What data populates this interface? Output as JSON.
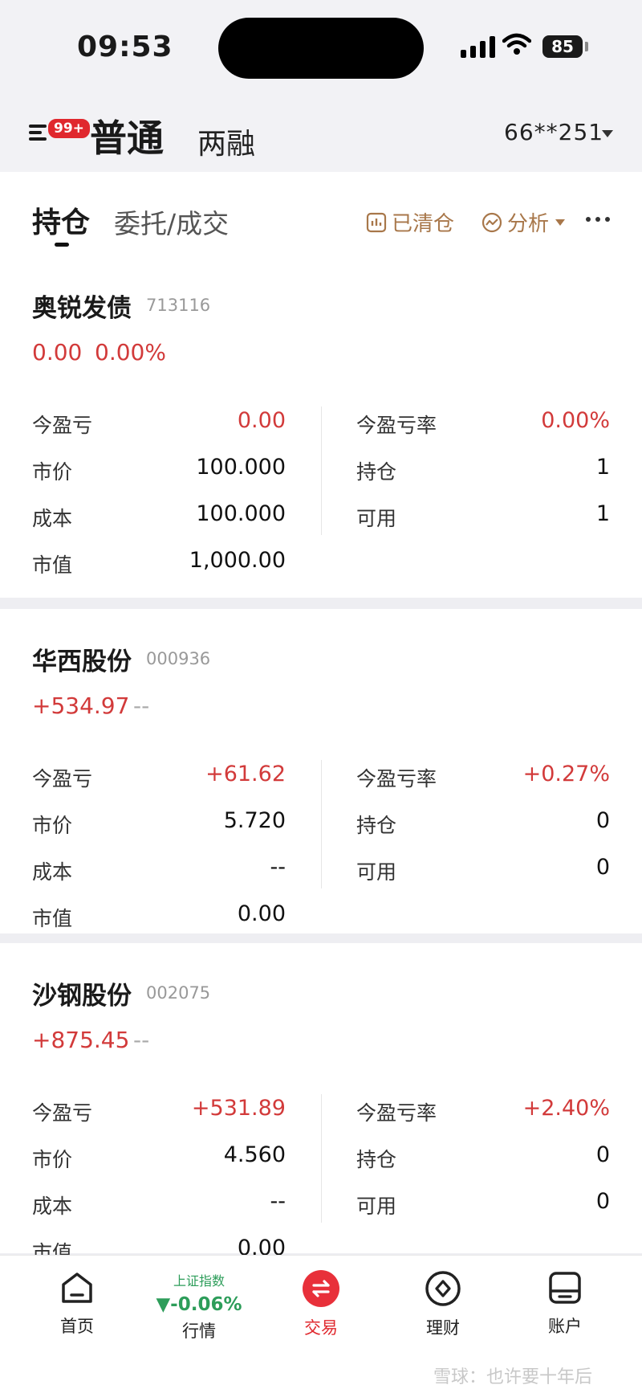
{
  "status_bar": {
    "time": "09:53",
    "battery": "85"
  },
  "header": {
    "badge": "99+",
    "tab_normal": "普通",
    "tab_margin": "两融",
    "account": "66**251"
  },
  "subtabs": {
    "positions": "持仓",
    "orders": "委托/成交",
    "cleared": "已清仓",
    "analysis": "分析"
  },
  "labels": {
    "today_pl": "今盈亏",
    "today_pl_rate": "今盈亏率",
    "price": "市价",
    "position": "持仓",
    "cost": "成本",
    "available": "可用",
    "market_value": "市值"
  },
  "holdings": [
    {
      "name": "奥锐发债",
      "code": "713116",
      "pl": "0.00",
      "pl_pct": "0.00%",
      "today_pl": "0.00",
      "today_pl_rate": "0.00%",
      "price": "100.000",
      "position": "1",
      "cost": "100.000",
      "available": "1",
      "market_value": "1,000.00"
    },
    {
      "name": "华西股份",
      "code": "000936",
      "pl": "+534.97",
      "pl_pct": "--",
      "today_pl": "+61.62",
      "today_pl_rate": "+0.27%",
      "price": "5.720",
      "position": "0",
      "cost": "--",
      "available": "0",
      "market_value": "0.00"
    },
    {
      "name": "沙钢股份",
      "code": "002075",
      "pl": "+875.45",
      "pl_pct": "--",
      "today_pl": "+531.89",
      "today_pl_rate": "+2.40%",
      "price": "4.560",
      "position": "0",
      "cost": "--",
      "available": "0",
      "market_value": "0.00"
    }
  ],
  "bottom_nav": {
    "home": "首页",
    "index_name": "上证指数",
    "index_value": "▼-0.06%",
    "market": "行情",
    "trade": "交易",
    "wealth": "理财",
    "account": "账户"
  },
  "watermark": "雪球：也许要十年后"
}
